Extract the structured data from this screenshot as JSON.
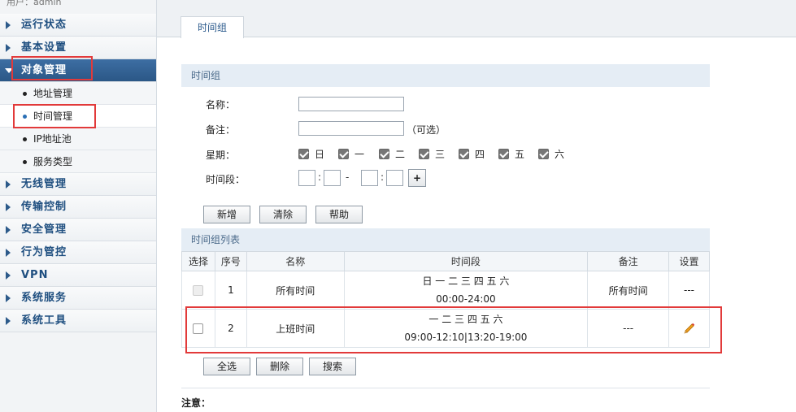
{
  "sidebar": {
    "user": "用户：admin",
    "menu": [
      {
        "label": "运行状态"
      },
      {
        "label": "基本设置"
      },
      {
        "label": "对象管理"
      },
      {
        "label": "无线管理"
      },
      {
        "label": "传输控制"
      },
      {
        "label": "安全管理"
      },
      {
        "label": "行为管控"
      },
      {
        "label": "VPN"
      },
      {
        "label": "系统服务"
      },
      {
        "label": "系统工具"
      }
    ],
    "submenu": [
      {
        "label": "地址管理"
      },
      {
        "label": "时间管理"
      },
      {
        "label": "IP地址池"
      },
      {
        "label": "服务类型"
      }
    ]
  },
  "tabs": {
    "active": "时间组"
  },
  "form": {
    "section_title": "时间组",
    "name_label": "名称：",
    "remark_label": "备注：",
    "optional_hint": "（可选）",
    "week_label": "星期：",
    "days": [
      "日",
      "一",
      "二",
      "三",
      "四",
      "五",
      "六"
    ],
    "period_label": "时间段：",
    "colon": ":",
    "dash": "-",
    "plus": "+",
    "buttons": {
      "add": "新增",
      "clear": "清除",
      "help": "帮助"
    }
  },
  "list": {
    "section_title": "时间组列表",
    "columns": [
      "选择",
      "序号",
      "名称",
      "时间段",
      "备注",
      "设置"
    ],
    "rows": [
      {
        "index": "1",
        "name": "所有时间",
        "days": "日 一 二 三 四 五 六",
        "time": "00:00-24:00",
        "remark": "所有时间",
        "settings": "---"
      },
      {
        "index": "2",
        "name": "上班时间",
        "days": "一 二 三 四 五 六",
        "time": "09:00-12:10|13:20-19:00",
        "remark": "---",
        "settings": "edit-icon"
      }
    ],
    "buttons": {
      "select_all": "全选",
      "delete": "删除",
      "search": "搜索"
    }
  },
  "notice": {
    "label": "注意："
  },
  "colors": {
    "accent": "#2b5786",
    "highlight": "#e23a3a",
    "header_bg": "#e5edf5"
  }
}
